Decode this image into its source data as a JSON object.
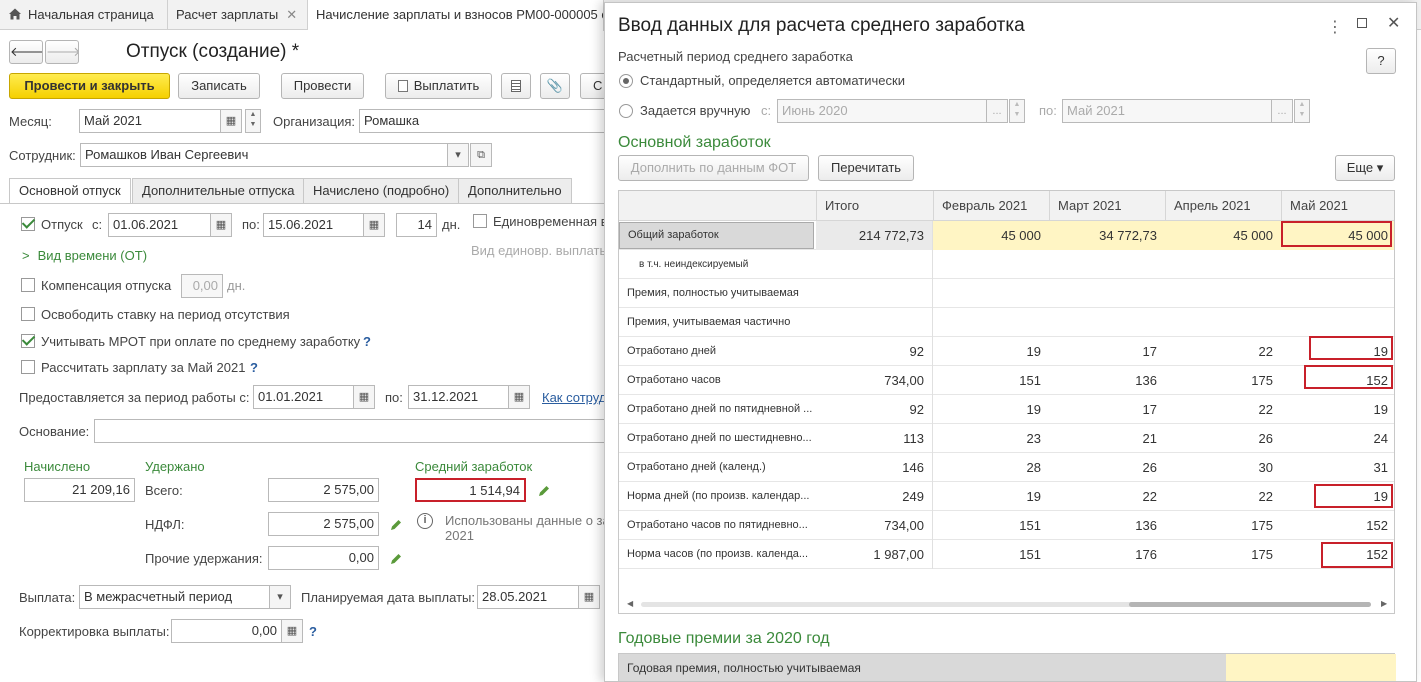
{
  "tabs": [
    {
      "label": "Начальная страница"
    },
    {
      "label": "Расчет зарплаты"
    },
    {
      "label": "Начисление зарплаты и взносов РМ00-000005 о"
    }
  ],
  "doc": {
    "title": "Отпуск (создание) *",
    "toolbar": {
      "post_close": "Провести и закрыть",
      "save": "Записать",
      "post": "Провести",
      "pay": "Выплатить",
      "more_cut": "С"
    },
    "month_label": "Месяц:",
    "month_value": "Май 2021",
    "org_label": "Организация:",
    "org_value": "Ромашка",
    "employee_label": "Сотрудник:",
    "employee_value": "Ромашков Иван Сергеевич",
    "form_tabs": [
      "Основной отпуск",
      "Дополнительные отпуска",
      "Начислено (подробно)",
      "Дополнительно"
    ],
    "vacation_label": "Отпуск",
    "from_label": "с:",
    "from_value": "01.06.2021",
    "to_label": "по:",
    "to_value": "15.06.2021",
    "days_value": "14",
    "days_unit": "дн.",
    "lump_label": "Единовременная в",
    "lump_kind_label": "Вид единовр. выплаты",
    "time_kind": "Вид времени (ОТ)",
    "compensation_label": "Компенсация отпуска",
    "compensation_value": "0,00",
    "compensation_unit": "дн.",
    "release_rate": "Освободить ставку на период отсутствия",
    "mrot": "Учитывать МРОТ при оплате по среднему заработку",
    "calc_salary": "Рассчитать зарплату за Май 2021",
    "period_label": "Предоставляется за период работы с:",
    "period_from": "01.01.2021",
    "period_to_label": "по:",
    "period_to": "31.12.2021",
    "how_link": "Как сотруд",
    "basis_label": "Основание:",
    "accrued_label": "Начислено",
    "accrued_value": "21 209,16",
    "withheld_label": "Удержано",
    "total_label": "Всего:",
    "total_value": "2 575,00",
    "ndfl_label": "НДФЛ:",
    "ndfl_value": "2 575,00",
    "other_label": "Прочие удержания:",
    "other_value": "0,00",
    "avg_label": "Средний заработок",
    "avg_value": "1 514,94",
    "info_text": "Использованы данные о за",
    "info_year": "2021",
    "payout_label": "Выплата:",
    "payout_value": "В межрасчетный период",
    "plan_date_label": "Планируемая дата выплаты:",
    "plan_date_value": "28.05.2021",
    "adjust_label": "Корректировка выплаты:",
    "adjust_value": "0,00",
    "q": "?"
  },
  "dialog": {
    "title": "Ввод данных для расчета среднего заработка",
    "period_label": "Расчетный период среднего заработка",
    "help": "?",
    "radio_standard": "Стандартный, определяется автоматически",
    "radio_manual": "Задается вручную",
    "from_label": "с:",
    "from_value": "Июнь 2020",
    "to_label": "по:",
    "to_value": "Май 2021",
    "main_section": "Основной заработок",
    "btn_fill": "Дополнить по данным ФОТ",
    "btn_recalc": "Перечитать",
    "btn_more": "Еще",
    "columns": [
      "",
      "Итого",
      "Февраль 2021",
      "Март 2021",
      "Апрель 2021",
      "Май 2021"
    ],
    "rows": [
      {
        "name": "Общий заработок",
        "vals": [
          "214 772,73",
          "45 000",
          "34 772,73",
          "45 000",
          "45 000"
        ]
      },
      {
        "name": "в т.ч. неиндексируемый",
        "vals": [
          "",
          "",
          "",
          "",
          ""
        ]
      },
      {
        "name": "Премия, полностью учитываемая",
        "vals": [
          "",
          "",
          "",
          "",
          ""
        ]
      },
      {
        "name": "Премия, учитываемая частично",
        "vals": [
          "",
          "",
          "",
          "",
          ""
        ]
      },
      {
        "name": "Отработано дней",
        "vals": [
          "92",
          "19",
          "17",
          "22",
          "19"
        ]
      },
      {
        "name": "Отработано часов",
        "vals": [
          "734,00",
          "151",
          "136",
          "175",
          "152"
        ]
      },
      {
        "name": "Отработано дней по пятидневной ...",
        "vals": [
          "92",
          "19",
          "17",
          "22",
          "19"
        ]
      },
      {
        "name": "Отработано дней по шестидневно...",
        "vals": [
          "113",
          "23",
          "21",
          "26",
          "24"
        ]
      },
      {
        "name": "Отработано дней (календ.)",
        "vals": [
          "146",
          "28",
          "26",
          "30",
          "31"
        ]
      },
      {
        "name": "Норма дней (по произв. календар...",
        "vals": [
          "249",
          "19",
          "22",
          "22",
          "19"
        ]
      },
      {
        "name": "Отработано часов по пятидневно...",
        "vals": [
          "734,00",
          "151",
          "136",
          "175",
          "152"
        ]
      },
      {
        "name": "Норма часов (по произв. календа...",
        "vals": [
          "1 987,00",
          "151",
          "176",
          "175",
          "152"
        ]
      }
    ],
    "annual_section": "Годовые премии за 2020 год",
    "annual_row": "Годовая премия, полностью учитываемая"
  }
}
